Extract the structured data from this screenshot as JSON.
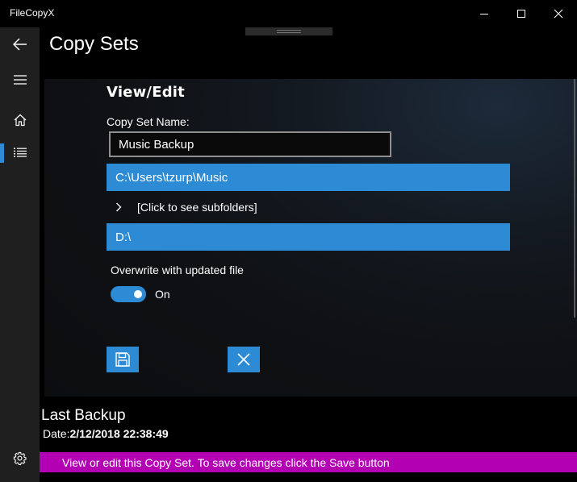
{
  "window": {
    "app_title": "FileCopyX"
  },
  "nav": {
    "items": [
      {
        "icon": "back-arrow-icon"
      },
      {
        "icon": "hamburger-menu-icon"
      },
      {
        "icon": "home-icon"
      },
      {
        "icon": "list-icon",
        "selected": true
      },
      {
        "icon": "gear-icon"
      }
    ],
    "accent": "#2f8ad6"
  },
  "header": {
    "title": "Copy Sets"
  },
  "editor": {
    "section_title": "View/Edit",
    "name_label": "Copy Set Name:",
    "name_value": "Music Backup",
    "source_path": "C:\\Users\\tzurp\\Music",
    "subfolders_label": "[Click to see subfolders]",
    "destination_path": "D:\\",
    "overwrite_label": "Overwrite with updated file",
    "overwrite_on": true,
    "overwrite_state": "On",
    "save_icon": "save-icon",
    "cancel_icon": "close-icon",
    "accent": "#2d8ad4"
  },
  "footer": {
    "last_backup_heading": "Last Backup",
    "date_label": "Date:",
    "date_value": "2/12/2018 22:38:49"
  },
  "status": {
    "message": "View or edit this Copy Set. To save changes click the Save button",
    "color": "#b300b3"
  }
}
